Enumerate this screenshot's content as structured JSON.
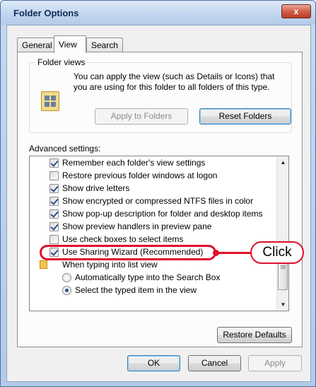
{
  "window": {
    "title": "Folder Options",
    "close_symbol": "x"
  },
  "tabs": [
    {
      "label": "General",
      "active": false
    },
    {
      "label": "View",
      "active": true
    },
    {
      "label": "Search",
      "active": false
    }
  ],
  "folder_views": {
    "group_label": "Folder views",
    "icon": "folder-view-icon",
    "description": "You can apply the view (such as Details or Icons) that you are using for this folder to all folders of this type.",
    "apply_button": "Apply to Folders",
    "apply_button_enabled": false,
    "reset_button": "Reset Folders"
  },
  "advanced": {
    "label": "Advanced settings:",
    "items": [
      {
        "type": "checkbox",
        "checked": true,
        "text": "Remember each folder's view settings"
      },
      {
        "type": "checkbox",
        "checked": false,
        "text": "Restore previous folder windows at logon"
      },
      {
        "type": "checkbox",
        "checked": true,
        "text": "Show drive letters"
      },
      {
        "type": "checkbox",
        "checked": true,
        "text": "Show encrypted or compressed NTFS files in color"
      },
      {
        "type": "checkbox",
        "checked": true,
        "text": "Show pop-up description for folder and desktop items"
      },
      {
        "type": "checkbox",
        "checked": true,
        "text": "Show preview handlers in preview pane"
      },
      {
        "type": "checkbox",
        "checked": false,
        "text": "Use check boxes to select items"
      },
      {
        "type": "checkbox",
        "checked": true,
        "text": "Use Sharing Wizard (Recommended)"
      },
      {
        "type": "folder",
        "text": "When typing into list view"
      },
      {
        "type": "radio",
        "checked": false,
        "text": "Automatically type into the Search Box"
      },
      {
        "type": "radio",
        "checked": true,
        "text": "Select the typed item in the view"
      }
    ]
  },
  "restore_defaults_button": "Restore Defaults",
  "footer": {
    "ok": "OK",
    "cancel": "Cancel",
    "apply": "Apply",
    "apply_enabled": false
  },
  "annotation": {
    "callout_text": "Click",
    "color": "#e0102a"
  }
}
